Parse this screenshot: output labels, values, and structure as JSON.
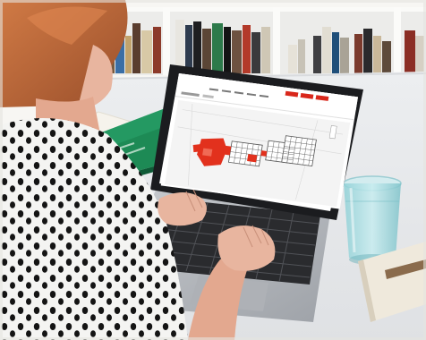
{
  "photo": {
    "subject": "woman-using-laptop",
    "colors": {
      "wall": "#f7f6f3",
      "shelf": "#ececea",
      "desk": "#e9eaec",
      "laptop_body": "#b9bcc1",
      "laptop_bezel": "#1b1c1f",
      "map_red": "#e2311d",
      "accent_red": "#d9271b",
      "book_green": "#1d8a55",
      "glass_water": "#9fd6dc",
      "shirt_white": "#f4f4f2",
      "shirt_dots": "#141414",
      "hair": "#b8643a",
      "skin": "#e8b59f"
    }
  },
  "screen": {
    "logo": "",
    "nav_buttons": 3,
    "map_blocks": 6
  }
}
